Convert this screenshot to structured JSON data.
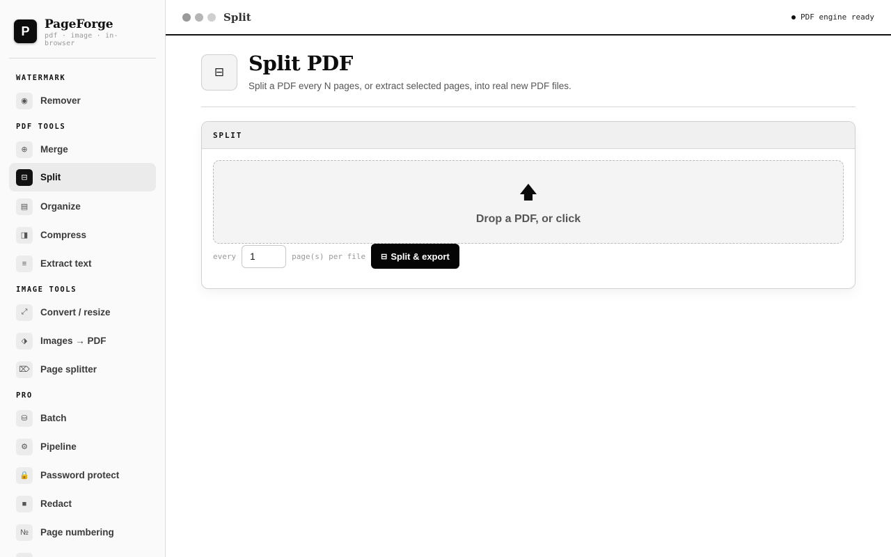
{
  "brand": {
    "logo_letter": "P",
    "name": "PageForge",
    "tagline": "pdf · image · in-browser"
  },
  "sidebar": {
    "sections": [
      {
        "title": "WATERMARK"
      },
      {
        "title": "PDF TOOLS"
      },
      {
        "title": "IMAGE TOOLS"
      },
      {
        "title": "PRO"
      }
    ],
    "items": [
      {
        "label": "Remover",
        "icon_glyph": "◉",
        "icon_name": "target-icon"
      },
      {
        "label": "Merge",
        "icon_glyph": "⊕",
        "icon_name": "merge-icon"
      },
      {
        "label": "Split",
        "icon_glyph": "⊟",
        "icon_name": "split-icon",
        "active": true
      },
      {
        "label": "Organize",
        "icon_glyph": "▤",
        "icon_name": "organize-icon"
      },
      {
        "label": "Compress",
        "icon_glyph": "◨",
        "icon_name": "compress-icon"
      },
      {
        "label": "Extract text",
        "icon_glyph": "≡",
        "icon_name": "text-icon"
      },
      {
        "label": "Convert / resize",
        "icon_glyph": "⤢",
        "icon_name": "resize-icon"
      },
      {
        "label": "Images → PDF",
        "icon_glyph": "⬗",
        "icon_name": "image-to-pdf-icon"
      },
      {
        "label": "Page splitter",
        "icon_glyph": "⌦",
        "icon_name": "page-splitter-icon"
      },
      {
        "label": "Batch",
        "icon_glyph": "⛁",
        "icon_name": "batch-icon"
      },
      {
        "label": "Pipeline",
        "icon_glyph": "⚙",
        "icon_name": "gear-icon"
      },
      {
        "label": "Password protect",
        "icon_glyph": "🔒",
        "icon_name": "lock-icon"
      },
      {
        "label": "Redact",
        "icon_glyph": "■",
        "icon_name": "redact-icon"
      },
      {
        "label": "Page numbering",
        "icon_glyph": "№",
        "icon_name": "numbering-icon"
      }
    ]
  },
  "topbar": {
    "title": "Split",
    "status": "PDF engine ready"
  },
  "header": {
    "icon_glyph": "⊟",
    "title": "Split PDF",
    "subtitle": "Split a PDF every N pages, or extract selected pages, into real new PDF files."
  },
  "card": {
    "title": "SPLIT",
    "dropzone": {
      "icon_glyph": "🡅",
      "label": "Drop a PDF, or click"
    },
    "controls": {
      "prefix": "every",
      "value": "1",
      "suffix": "page(s) per file",
      "button_icon": "⊟",
      "button_label": "Split & export"
    }
  },
  "colors": {
    "accent": "#111111",
    "active_bg": "#ebebeb",
    "dropzone_bg": "#f4f4f4"
  }
}
